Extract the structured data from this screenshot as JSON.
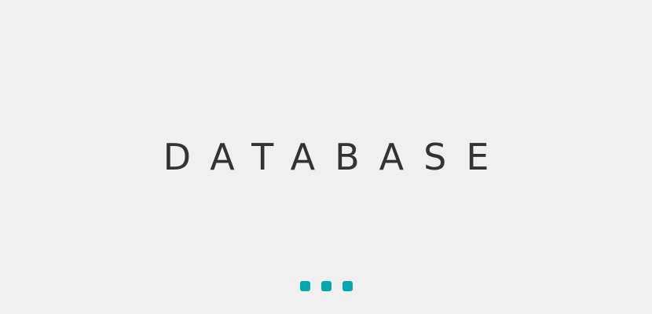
{
  "screen": {
    "title": "DATABASE"
  },
  "loader": {
    "dot_count": 3,
    "color": "#00a9b0"
  },
  "colors": {
    "background": "#f0f0f0",
    "text": "#333333"
  }
}
